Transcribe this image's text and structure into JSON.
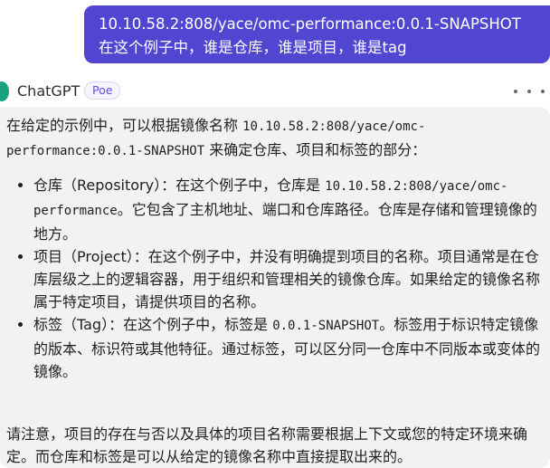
{
  "user_message": {
    "line1": "10.10.58.2:808/yace/omc-performance:0.0.1-SNAPSHOT",
    "line2": "在这个例子中，谁是仓库，谁是项目，谁是tag"
  },
  "bot": {
    "name": "ChatGPT",
    "badge": "Poe"
  },
  "answer": {
    "intro_a": "在给定的示例中，可以根据镜像名称 ",
    "intro_code": "10.10.58.2:808/yace/omc-performance:0.0.1-SNAPSHOT",
    "intro_b": " 来确定仓库、项目和标签的部分：",
    "items": [
      {
        "a": "仓库（Repository）：在这个例子中，仓库是 ",
        "code": "10.10.58.2:808/yace/omc-performance",
        "b": "。它包含了主机地址、端口和仓库路径。仓库是存储和管理镜像的地方。"
      },
      {
        "a": "项目（Project）：在这个例子中，并没有明确提到项目的名称。项目通常是在仓库层级之上的逻辑容器，用于组织和管理相关的镜像仓库。如果给定的镜像名称属于特定项目，请提供项目的名称。",
        "code": "",
        "b": ""
      },
      {
        "a": "标签（Tag）：在这个例子中，标签是 ",
        "code": "0.0.1-SNAPSHOT",
        "b": "。标签用于标识特定镜像的版本、标识符或其他特征。通过标签，可以区分同一仓库中不同版本或变体的镜像。"
      }
    ],
    "note": "请注意，项目的存在与否以及具体的项目名称需要根据上下文或您的特定环境来确定。而仓库和标签是可以从给定的镜像名称中直接提取出来的。"
  },
  "colors": {
    "user_bubble": "#5046d1",
    "answer_card": "#f2f2f4",
    "badge_text": "#5b4fd6"
  },
  "icons": {
    "avatar": "chatgpt-logo-icon",
    "more": "more-horizontal-icon"
  }
}
